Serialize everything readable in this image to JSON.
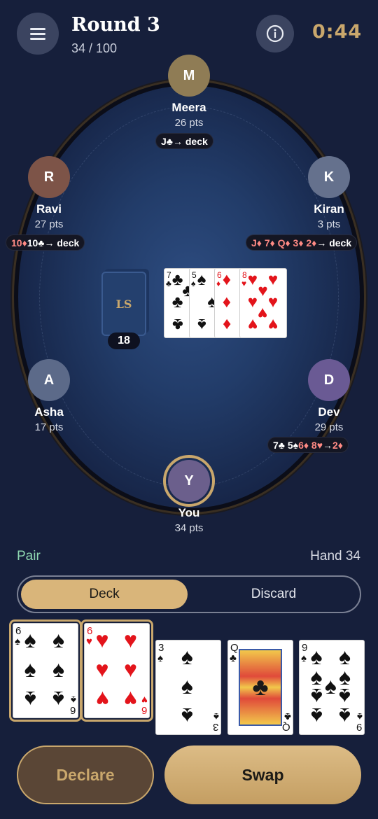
{
  "header": {
    "title": "Round 3",
    "progress": "34 / 100",
    "timer": "0:44"
  },
  "players": {
    "meera": {
      "initial": "M",
      "name": "Meera",
      "points": "26 pts",
      "action": [
        "J♣",
        " → deck"
      ]
    },
    "ravi": {
      "initial": "R",
      "name": "Ravi",
      "points": "27 pts",
      "action": [
        "10♦",
        " 10♣",
        " → deck"
      ]
    },
    "kiran": {
      "initial": "K",
      "name": "Kiran",
      "points": "3 pts",
      "action": [
        "J♦ 7♦ Q♦ 3♦ 2♦",
        " → deck"
      ]
    },
    "asha": {
      "initial": "A",
      "name": "Asha",
      "points": "17 pts"
    },
    "dev": {
      "initial": "D",
      "name": "Dev",
      "points": "29 pts",
      "action": [
        "7♣ 5♠",
        " 6♦ 8♥",
        " → ",
        "2♦"
      ]
    },
    "you": {
      "initial": "Y",
      "name": "You",
      "points": "34 pts"
    }
  },
  "deck": {
    "logo": "LS",
    "count": "18"
  },
  "discard_pile": [
    {
      "rank": "7",
      "suit": "♣"
    },
    {
      "rank": "5",
      "suit": "♠"
    },
    {
      "rank": "6",
      "suit": "♦"
    },
    {
      "rank": "8",
      "suit": "♥"
    }
  ],
  "hand": {
    "type": "Pair",
    "value_label": "Hand 34",
    "cards": [
      {
        "rank": "6",
        "suit": "♠",
        "selected": true
      },
      {
        "rank": "6",
        "suit": "♥",
        "selected": true
      },
      {
        "rank": "3",
        "suit": "♠",
        "selected": false
      },
      {
        "rank": "Q",
        "suit": "♣",
        "selected": false
      },
      {
        "rank": "9",
        "suit": "♠",
        "selected": false
      }
    ]
  },
  "draw_source": {
    "options": [
      "Deck",
      "Discard"
    ],
    "selected": "Deck"
  },
  "actions": {
    "declare": "Declare",
    "swap": "Swap"
  },
  "colors": {
    "background": "#161f3b",
    "gold": "#c9a76c",
    "pair_green": "#8fd8b1",
    "avatars": {
      "M": "#8f7c55",
      "R": "#7d5448",
      "K": "#65718d",
      "A": "#5c6a89",
      "D": "#6a5a94",
      "Y": "#6b5f8c"
    }
  }
}
